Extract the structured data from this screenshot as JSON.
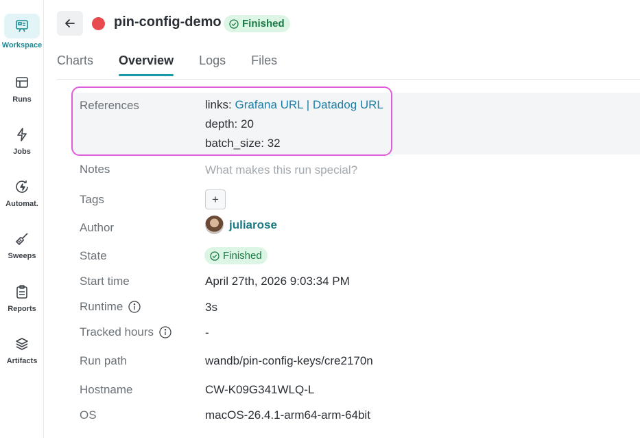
{
  "nav": {
    "items": [
      {
        "label": "Workspace",
        "icon": "workspace-icon",
        "active": true
      },
      {
        "label": "Runs",
        "icon": "runs-table-icon"
      },
      {
        "label": "Jobs",
        "icon": "lightning-icon"
      },
      {
        "label": "Automat.",
        "icon": "automation-icon"
      },
      {
        "label": "Sweeps",
        "icon": "broom-icon"
      },
      {
        "label": "Reports",
        "icon": "clipboard-icon"
      },
      {
        "label": "Artifacts",
        "icon": "layers-icon"
      }
    ]
  },
  "header": {
    "run_name": "pin-config-demo",
    "status": "Finished",
    "state_color": "#e74a4f"
  },
  "tabs": [
    "Charts",
    "Overview",
    "Logs",
    "Files"
  ],
  "active_tab": "Overview",
  "overview": {
    "references": {
      "label": "References",
      "links_prefix": "links: ",
      "link1": "Grafana URL",
      "separator": " | ",
      "link2": "Datadog URL",
      "depth": "depth: 20",
      "batch_size": "batch_size: 32"
    },
    "notes": {
      "label": "Notes",
      "placeholder": "What makes this run special?"
    },
    "tags": {
      "label": "Tags",
      "add": "+"
    },
    "author": {
      "label": "Author",
      "name": "juliarose"
    },
    "state": {
      "label": "State",
      "value": "Finished"
    },
    "start_time": {
      "label": "Start time",
      "value": "April 27th, 2026 9:03:34 PM"
    },
    "runtime": {
      "label": "Runtime",
      "value": "3s"
    },
    "tracked_hours": {
      "label": "Tracked hours",
      "value": "-"
    },
    "run_path": {
      "label": "Run path",
      "value": "wandb/pin-config-keys/cre2170n"
    },
    "hostname": {
      "label": "Hostname",
      "value": "CW-K09G341WLQ-L"
    },
    "os": {
      "label": "OS",
      "value": "macOS-26.4.1-arm64-arm-64bit"
    }
  },
  "colors": {
    "accent": "#1a9aa8",
    "highlight_outline": "#e05cdc",
    "success": "#1a7a45"
  }
}
